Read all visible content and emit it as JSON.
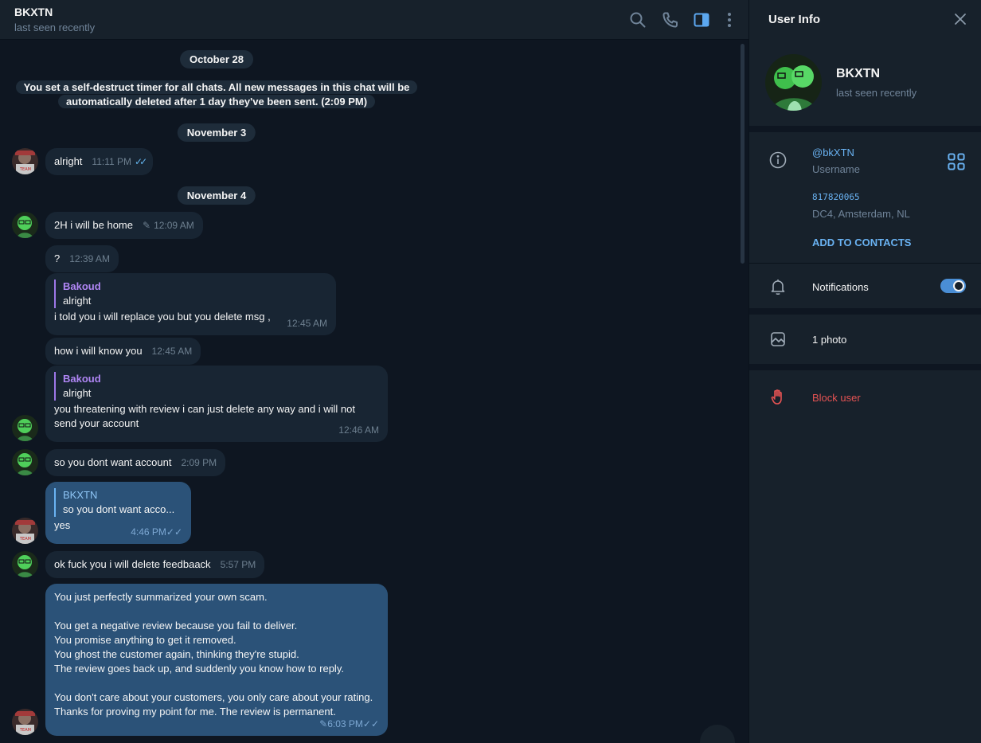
{
  "header": {
    "name": "BKXTN",
    "status": "last seen recently"
  },
  "dates": {
    "oct28": "October 28",
    "nov3": "November 3",
    "nov4": "November 4"
  },
  "service_message": "You set a self-destruct timer for all chats. All new messages in this chat will be automatically deleted after 1 day they've been sent. (2:09 PM)",
  "messages": [
    {
      "text": "alright",
      "time": "11:11 PM"
    },
    {
      "text": "2H i will be home",
      "time": "12:09 AM"
    },
    {
      "text": "?",
      "time": "12:39 AM"
    },
    {
      "reply_name": "Bakoud",
      "reply_text": "alright",
      "text": "i told you i will replace you but you delete msg ,",
      "time": "12:45 AM"
    },
    {
      "text": "how i will know you",
      "time": "12:45 AM"
    },
    {
      "reply_name": "Bakoud",
      "reply_text": "alright",
      "text": "you threatening with review i can just delete any way and i will not send your account",
      "time": "12:46 AM"
    },
    {
      "text": "so you dont want account",
      "time": "2:09 PM"
    },
    {
      "reply_name": "BKXTN",
      "reply_text": "so you dont want acco...",
      "text": "yes",
      "time": "4:46 PM"
    },
    {
      "text": "ok fuck you i will delete feedbaack",
      "time": "5:57 PM"
    },
    {
      "text": "You just perfectly summarized your own scam.\n\nYou get a negative review because you fail to deliver.\nYou promise anything to get it removed.\nYou ghost the customer again, thinking they're stupid.\nThe review goes back up, and suddenly you know how to reply.\n\nYou don't care about your customers, you only care about your rating. Thanks for proving my point for me. The review is permanent.",
      "time": "6:03 PM"
    }
  ],
  "panel": {
    "title": "User Info",
    "name": "BKXTN",
    "status": "last seen recently",
    "username": "@bkXTN",
    "username_label": "Username",
    "id": "817820065",
    "dc": "DC4, Amsterdam, NL",
    "add_contacts": "ADD TO CONTACTS",
    "notifications": "Notifications",
    "notifications_on": true,
    "photos": "1 photo",
    "block": "Block user"
  },
  "colors": {
    "bg": "#0e1621",
    "panel": "#17212b",
    "incoming": "#182533",
    "outgoing": "#2b5278",
    "accent": "#6ab3f3",
    "reply_purple": "#b086f5",
    "danger": "#e55353"
  }
}
